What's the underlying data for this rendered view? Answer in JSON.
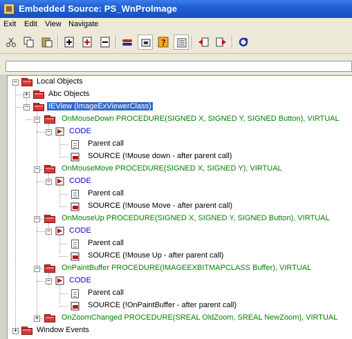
{
  "window": {
    "title": "Embedded Source: PS_WnProImage"
  },
  "menu": [
    "Exit",
    "Edit",
    "View",
    "Navigate"
  ],
  "toolbar": {
    "buttons": [
      {
        "name": "cut-icon"
      },
      {
        "name": "copy-icon"
      },
      {
        "name": "paste-icon"
      },
      {
        "name": "insert-icon"
      },
      {
        "name": "insert-red-icon"
      },
      {
        "name": "delete-icon"
      },
      {
        "name": "code-view-icon"
      },
      {
        "name": "toggle-view-icon"
      },
      {
        "name": "help-icon"
      },
      {
        "name": "properties-icon"
      },
      {
        "name": "previous-icon"
      },
      {
        "name": "next-icon"
      },
      {
        "name": "refresh-icon"
      }
    ]
  },
  "editor": {
    "value": ""
  },
  "tree": {
    "local_objects": "Local Objects",
    "abc_objects": "Abc Objects",
    "ieview": "IEView (ImageExViewerClass)",
    "methods": [
      {
        "signature": "OnMouseDown PROCEDURE(SIGNED X, SIGNED Y, SIGNED Button), VIRTUAL",
        "code": "CODE",
        "parent": "Parent call",
        "source": "SOURCE (!Mouse down - after parent call)"
      },
      {
        "signature": "OnMouseMove PROCEDURE(SIGNED X, SIGNED Y), VIRTUAL",
        "code": "CODE",
        "parent": "Parent call",
        "source": "SOURCE (!Mouse Move - after parent call)"
      },
      {
        "signature": "OnMouseUp PROCEDURE(SIGNED X, SIGNED Y, SIGNED Button), VIRTUAL",
        "code": "CODE",
        "parent": "Parent call",
        "source": "SOURCE (!Mouse Up - after parent call)"
      },
      {
        "signature": "OnPaintBuffer PROCEDURE(IMAGEEXBITMAPCLASS Buffer), VIRTUAL",
        "code": "CODE",
        "parent": "Parent call",
        "source": "SOURCE (!OnPaintBuffer - after parent call)"
      }
    ],
    "zoom_changed": "OnZoomChanged PROCEDURE(SREAL OldZoom, SREAL NewZoom), VIRTUAL",
    "window_events": "Window Events"
  },
  "colors": {
    "title_bar": "#1f5fd6",
    "selection": "#316ac5",
    "method_text": "#008000",
    "code_text": "#0000cc",
    "folder_red": "#d83838"
  }
}
